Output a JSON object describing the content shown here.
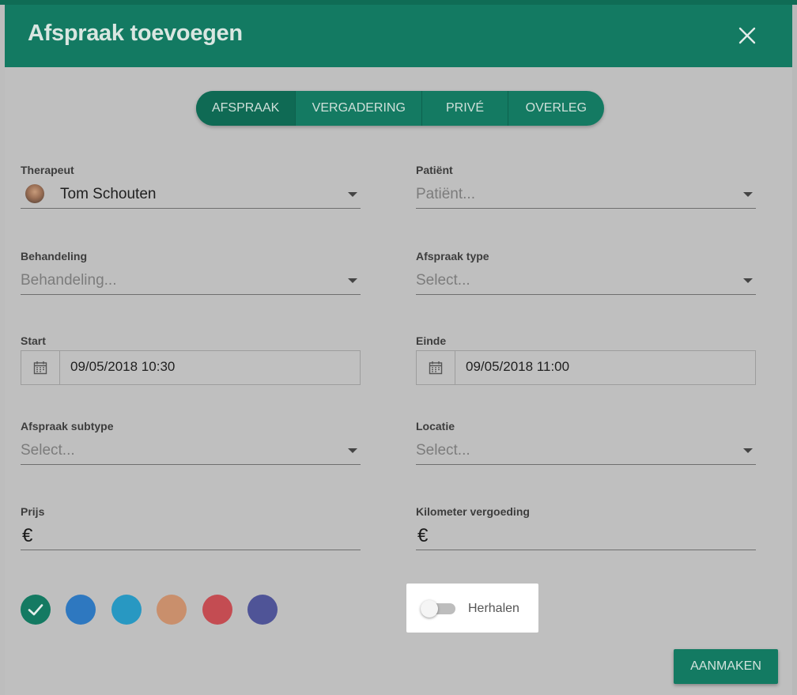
{
  "dialog": {
    "title": "Afspraak toevoegen"
  },
  "tabs": [
    {
      "label": "AFSPRAAK",
      "active": true
    },
    {
      "label": "VERGADERING",
      "active": false
    },
    {
      "label": "PRIVÉ",
      "active": false
    },
    {
      "label": "OVERLEG",
      "active": false
    }
  ],
  "form": {
    "therapeut": {
      "label": "Therapeut",
      "value": "Tom Schouten"
    },
    "patient": {
      "label": "Patiënt",
      "placeholder": "Patiënt..."
    },
    "behandeling": {
      "label": "Behandeling",
      "placeholder": "Behandeling..."
    },
    "afspraak_type": {
      "label": "Afspraak type",
      "placeholder": "Select..."
    },
    "start": {
      "label": "Start",
      "value": "09/05/2018 10:30"
    },
    "einde": {
      "label": "Einde",
      "value": "09/05/2018 11:00"
    },
    "afspraak_subtype": {
      "label": "Afspraak subtype",
      "placeholder": "Select..."
    },
    "locatie": {
      "label": "Locatie",
      "placeholder": "Select..."
    },
    "prijs": {
      "label": "Prijs",
      "symbol": "€"
    },
    "kilometer": {
      "label": "Kilometer vergoeding",
      "symbol": "€"
    }
  },
  "colors": {
    "selected": "#147a62",
    "options": [
      "#147a62",
      "#2e78c0",
      "#2898c2",
      "#c98f6c",
      "#c44c52",
      "#4f5497"
    ]
  },
  "repeat_toggle": {
    "label": "Herhalen",
    "on": false
  },
  "submit": {
    "label": "AANMAKEN"
  }
}
